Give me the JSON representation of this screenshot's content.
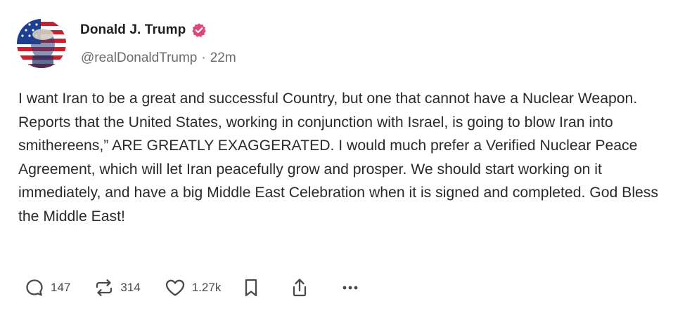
{
  "author": {
    "display_name": "Donald J. Trump",
    "handle": "@realDonaldTrump",
    "separator": "·",
    "time_ago": "22m",
    "verified_badge_color": "#e0467c"
  },
  "post": {
    "text": "I want Iran to be a great and successful Country, but one that cannot have a Nuclear Weapon. Reports that the United States, working in conjunction with Israel, is going to blow Iran into smithereens,” ARE GREATLY EXAGGERATED. I would much prefer a Verified Nuclear Peace Agreement, which will let Iran peacefully grow and prosper. We should start working on it immediately, and have a big Middle East Celebration when it is signed and completed. God Bless the Middle East!"
  },
  "actions": {
    "reply": {
      "icon": "reply-icon",
      "count": "147"
    },
    "repost": {
      "icon": "repost-icon",
      "count": "314"
    },
    "like": {
      "icon": "heart-icon",
      "count": "1.27k"
    },
    "bookmark": {
      "icon": "bookmark-icon"
    },
    "share": {
      "icon": "share-icon"
    },
    "more": {
      "icon": "more-icon"
    }
  },
  "colors": {
    "text": "#2a2a2a",
    "muted": "#6b6b6b",
    "icon": "#4a4a4a"
  }
}
